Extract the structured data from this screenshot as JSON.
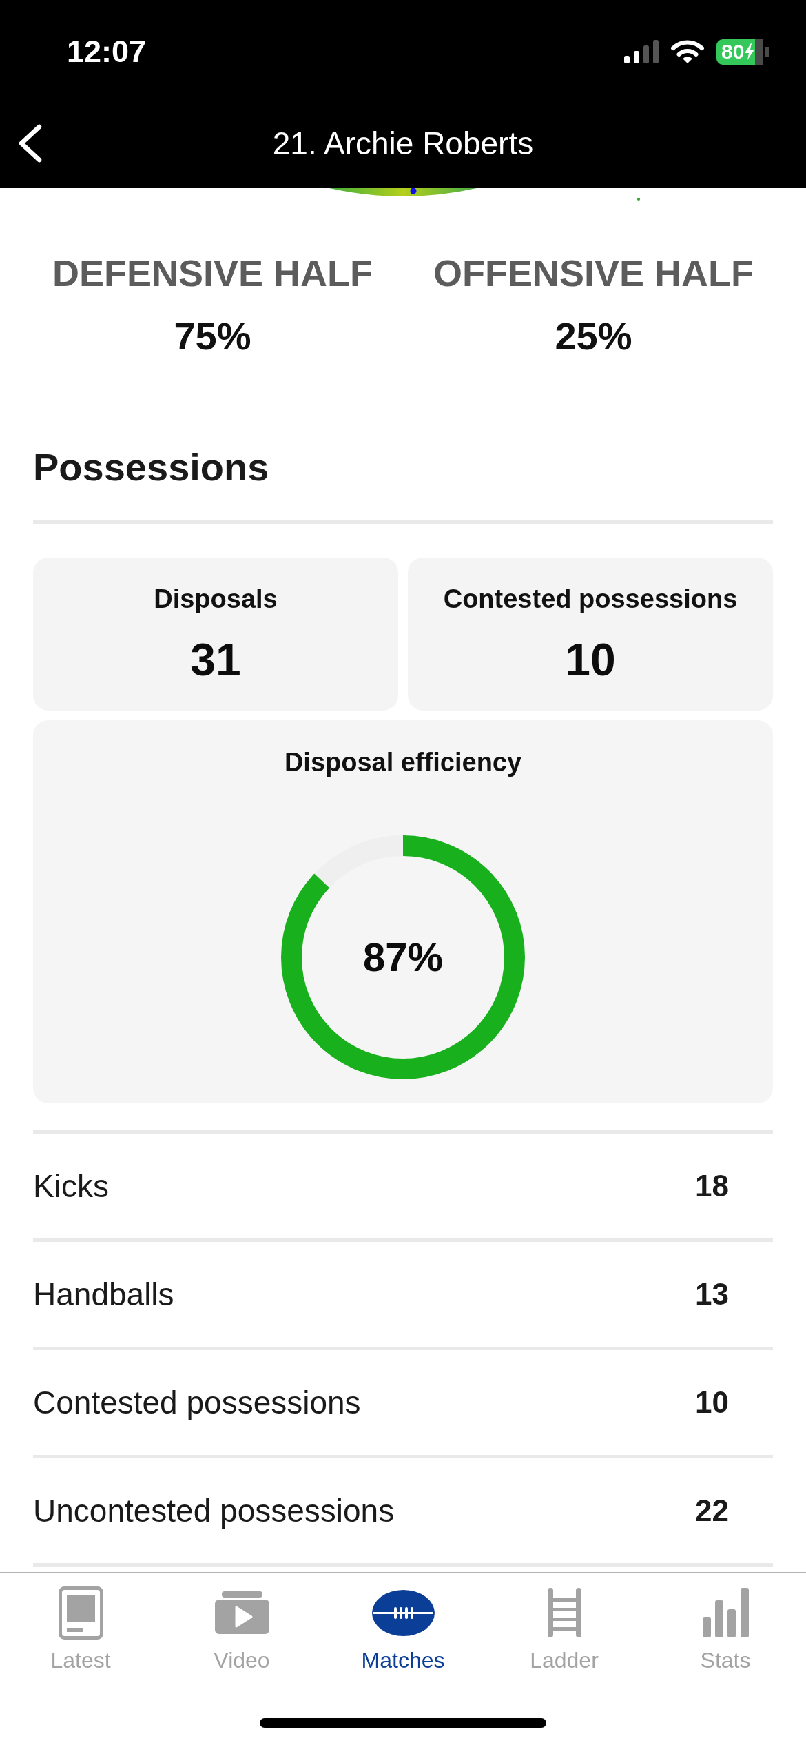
{
  "status_bar": {
    "time": "12:07",
    "battery": "80"
  },
  "header": {
    "title": "21. Archie Roberts"
  },
  "field_halves": [
    {
      "label": "DEFENSIVE HALF",
      "value": "75%"
    },
    {
      "label": "OFFENSIVE HALF",
      "value": "25%"
    }
  ],
  "possessions": {
    "title": "Possessions",
    "cards": [
      {
        "label": "Disposals",
        "value": "31"
      },
      {
        "label": "Contested possessions",
        "value": "10"
      }
    ],
    "efficiency": {
      "label": "Disposal efficiency",
      "value": "87%",
      "level": 0.87
    },
    "rows": [
      {
        "label": "Kicks",
        "value": "18"
      },
      {
        "label": "Handballs",
        "value": "13"
      },
      {
        "label": "Contested possessions",
        "value": "10"
      },
      {
        "label": "Uncontested possessions",
        "value": "22"
      }
    ]
  },
  "tab_bar": [
    {
      "label": "Latest",
      "kind": "document",
      "selected": false
    },
    {
      "label": "Video",
      "kind": "video",
      "selected": false
    },
    {
      "label": "Matches",
      "kind": "football",
      "selected": true
    },
    {
      "label": "Ladder",
      "kind": "ladder",
      "selected": false
    },
    {
      "label": "Stats",
      "kind": "chart",
      "selected": false
    }
  ]
}
